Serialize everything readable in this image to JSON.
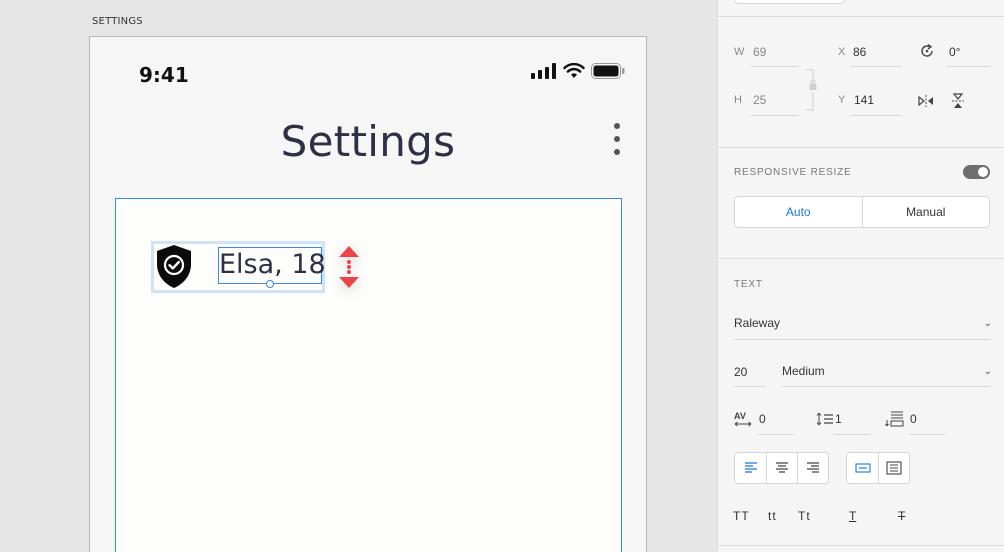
{
  "artboard": {
    "label": "SETTINGS",
    "status_time": "9:41",
    "screen_title": "Settings",
    "card": {
      "name_text": "Elsa, 18"
    }
  },
  "panel": {
    "transform": {
      "w_label": "W",
      "w_value": "69",
      "x_label": "X",
      "x_value": "86",
      "rotation_value": "0°",
      "h_label": "H",
      "h_value": "25",
      "y_label": "Y",
      "y_value": "141"
    },
    "responsive": {
      "title": "RESPONSIVE RESIZE",
      "enabled": true,
      "auto_label": "Auto",
      "manual_label": "Manual"
    },
    "text": {
      "title": "TEXT",
      "font_family": "Raleway",
      "font_size": "20",
      "font_weight": "Medium",
      "char_spacing": "0",
      "line_spacing": "1",
      "paragraph_spacing": "0",
      "case_uppercase": "TT",
      "case_lowercase": "tt",
      "case_titlecase": "Tt",
      "underline": "T",
      "strikethrough": "T"
    }
  },
  "colors": {
    "selection": "#3b8ad9",
    "selection_group": "#cfe3f4",
    "resize_arrow": "#e8454a",
    "accent_blue": "#1a7bd4",
    "title_text": "#2f2f45"
  }
}
